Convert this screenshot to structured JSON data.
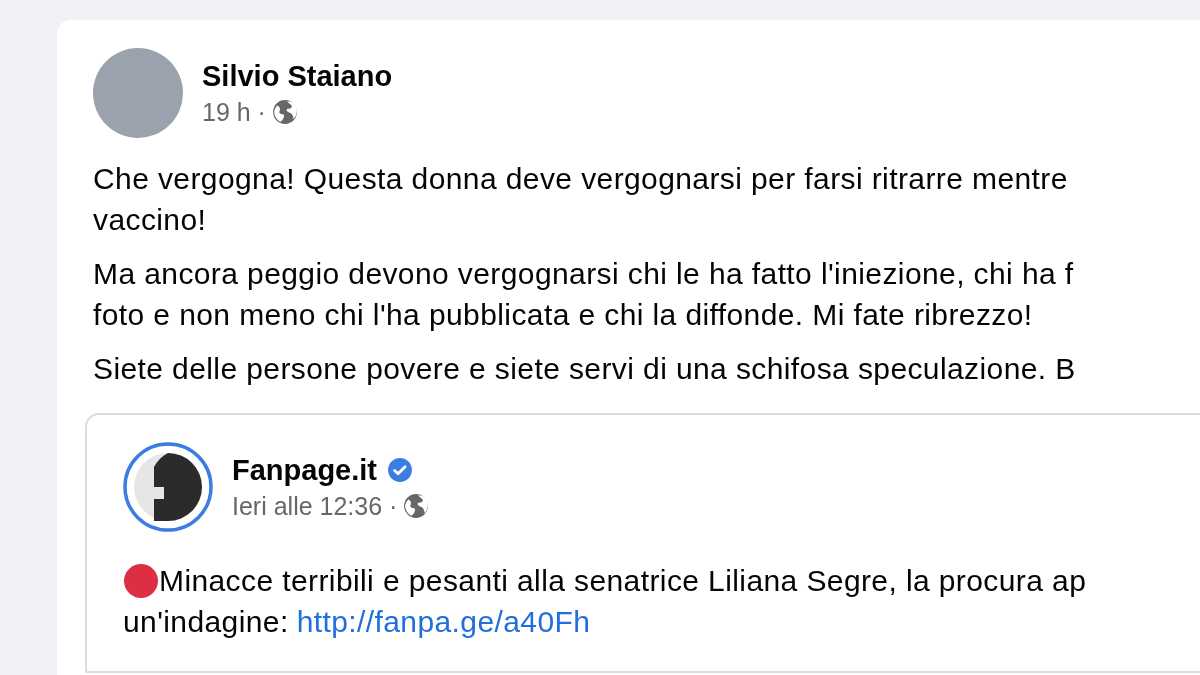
{
  "post": {
    "author": "Silvio Staiano",
    "time": "19 h ·",
    "paragraphs": [
      [
        "Che vergogna! Questa donna deve vergognarsi per farsi ritrarre mentre",
        "vaccino!"
      ],
      [
        "Ma ancora peggio devono vergognarsi chi le ha fatto l'iniezione, chi ha f",
        "foto e non meno chi l'ha pubblicata  e chi la diffonde. Mi fate ribrezzo!"
      ],
      [
        "Siete delle persone povere  e siete servi di una schifosa speculazione. B"
      ]
    ],
    "shared": {
      "page": "Fanpage.it",
      "verified": true,
      "time": "Ieri alle 12:36 ·",
      "line_1": "Minacce terribili e pesanti alla senatrice Liliana Segre, la procura ap",
      "line_2": "un'indagine:",
      "link": "http://fanpa.ge/a40Fh"
    }
  }
}
